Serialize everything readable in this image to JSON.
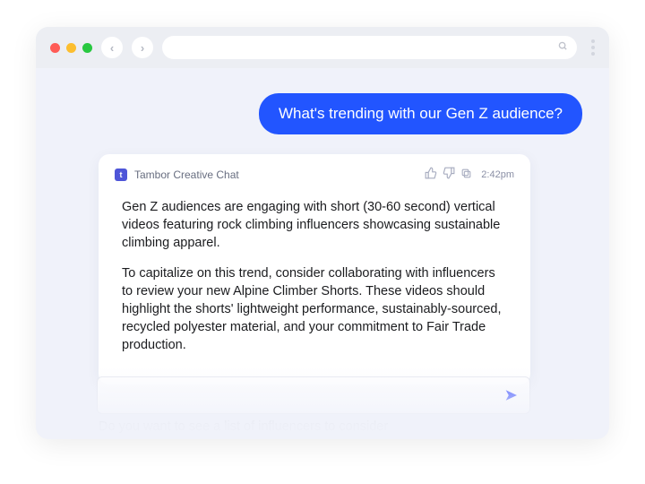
{
  "browser": {
    "back_glyph": "‹",
    "forward_glyph": "›",
    "url": "",
    "search_icon_name": "search-icon"
  },
  "conversation": {
    "user_message": "What's trending with our Gen Z audience?"
  },
  "response": {
    "brand_char": "t",
    "chat_title": "Tambor Creative Chat",
    "timestamp": "2:42pm",
    "paragraph1": "Gen Z audiences are engaging with short (30-60 second) vertical videos featuring rock climbing influencers showcasing sustainable climbing apparel.",
    "paragraph2": "To capitalize on this trend, consider collaborating with influencers to review your new Alpine Climber Shorts. These videos should highlight the shorts' lightweight performance, sustainably-sourced, recycled polyester material, and your commitment to Fair Trade production.",
    "followup": "Do you want to see a list of influencers to consider"
  },
  "composer": {
    "placeholder": "",
    "send_glyph": "➤"
  },
  "icons": {
    "thumb_up": "👍",
    "thumb_down": "👎"
  }
}
